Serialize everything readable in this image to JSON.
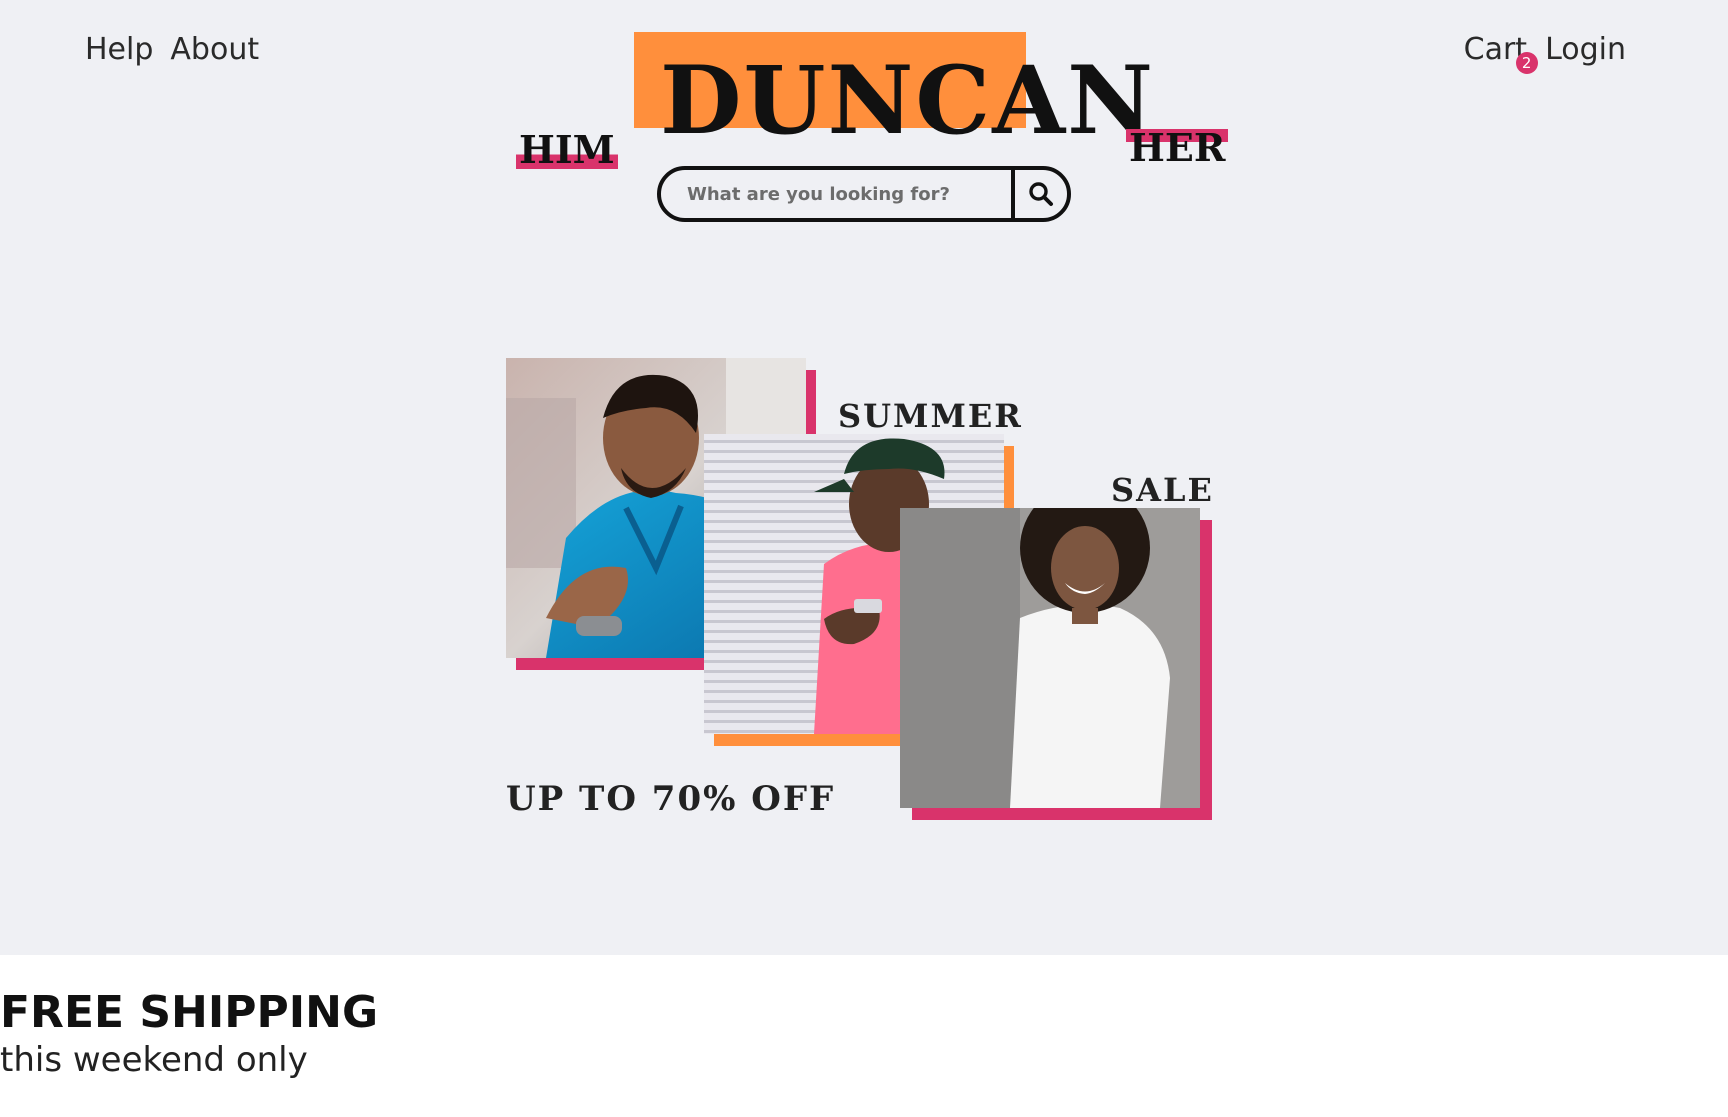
{
  "nav": {
    "help": "Help",
    "about": "About",
    "cart": "Cart",
    "cart_count": "2",
    "login": "Login"
  },
  "brand": {
    "logo": "DUNCAN",
    "accent_orange": "#ff8f3c",
    "accent_pink": "#d9336b"
  },
  "gender_links": {
    "him": "HIM",
    "her": "HER"
  },
  "search": {
    "placeholder": "What are you looking for?",
    "icon": "search-icon"
  },
  "promo": {
    "summer": "SUMMER",
    "sale": "SALE",
    "discount": "UP TO 70% OFF"
  },
  "banner": {
    "title": "FREE SHIPPING",
    "subtitle": "this weekend only"
  }
}
